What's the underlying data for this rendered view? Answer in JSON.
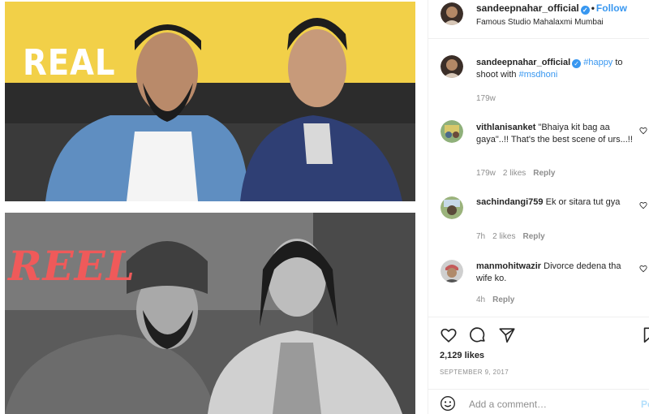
{
  "media": {
    "top_label": "REAL",
    "bottom_label": "REEL",
    "top_photo_icon": "photo-icon",
    "bottom_photo_icon": "photo-icon"
  },
  "header": {
    "username": "sandeepnahar_official",
    "follow_label": "Follow",
    "location": "Famous Studio Mahalaxmi Mumbai",
    "verified_icon": "verified-badge-icon"
  },
  "caption": {
    "username": "sandeepnahar_official",
    "text_before": "",
    "hashtag_1": "#happy",
    "text_middle": " to shoot with ",
    "hashtag_2": "#msdhoni",
    "time": "179w"
  },
  "comments": [
    {
      "username": "vithlanisanket",
      "text": "\"Bhaiya kit bag aa gaya\"..!! That's the best scene of urs...!!",
      "time": "179w",
      "likes": "2 likes",
      "reply": "Reply"
    },
    {
      "username": "sachindangi759",
      "text": "Ek or sitara tut gya",
      "time": "7h",
      "likes": "2 likes",
      "reply": "Reply"
    },
    {
      "username": "manmohitwazir",
      "text": "Divorce dedena tha wife ko.",
      "time": "4h",
      "likes": "",
      "reply": "Reply"
    }
  ],
  "actions": {
    "like_icon": "heart-icon",
    "comment_icon": "comment-icon",
    "share_icon": "share-icon",
    "save_icon": "bookmark-icon"
  },
  "likes_text": "2,129 likes",
  "date_text": "SEPTEMBER 9, 2017",
  "add_comment": {
    "placeholder": "Add a comment…",
    "post_label": "Post",
    "emoji_icon": "emoji-icon"
  },
  "colors": {
    "accent": "#3897f0",
    "label_reel": "#ef5a5a",
    "top_background": "#f3d34a"
  }
}
